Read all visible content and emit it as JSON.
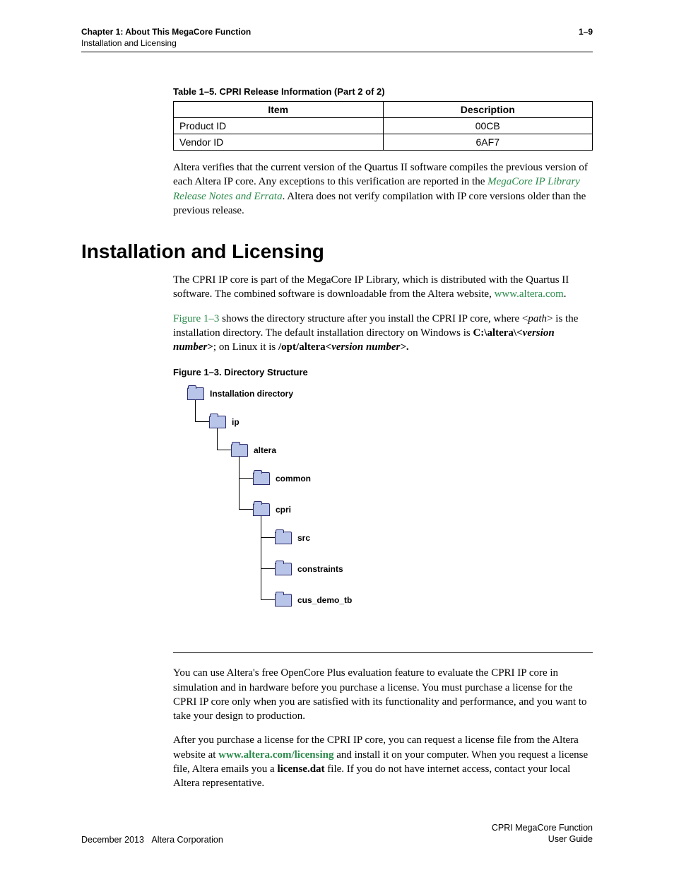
{
  "header": {
    "chapter": "Chapter 1: About This MegaCore Function",
    "section": "Installation and Licensing",
    "pagenum": "1–9"
  },
  "table": {
    "caption": "Table 1–5. CPRI Release Information  (Part 2 of 2)",
    "head_item": "Item",
    "head_desc": "Description",
    "rows": [
      {
        "item": "Product ID",
        "desc": "00CB"
      },
      {
        "item": "Vendor ID",
        "desc": "6AF7"
      }
    ]
  },
  "para1_a": "Altera verifies that the current version of the Quartus II software compiles the previous version of each Altera IP core. Any exceptions to this verification are reported in the ",
  "para1_link": "MegaCore IP Library Release Notes and Errata",
  "para1_b": ". Altera does not verify compilation with IP core versions older than the previous release.",
  "h1": "Installation and Licensing",
  "para2_a": "The CPRI IP core is part of the MegaCore IP Library, which is distributed with the Quartus II software. The combined software is downloadable from the Altera website, ",
  "para2_link": "www.altera.com",
  "para2_b": ".",
  "para3_ref": "Figure 1–3",
  "para3_a": " shows the directory structure after you install the CPRI IP core, where ",
  "para3_path_pre": "<",
  "para3_path": "path",
  "para3_path_post": ">",
  "para3_b": " is the installation directory. The default installation directory on Windows is ",
  "para3_win_a": "C:\\altera\\<",
  "para3_win_i": "version number",
  "para3_win_b": ">",
  "para3_c": "; on Linux it is ",
  "para3_lin_a": "/opt/altera",
  "para3_lin_i": "<version number>",
  "para3_lin_b": ".",
  "figure_caption": "Figure 1–3. Directory Structure",
  "tree": {
    "n0": "Installation directory",
    "n1": "ip",
    "n2": "altera",
    "n3": "common",
    "n4": "cpri",
    "n5": "src",
    "n6": "constraints",
    "n7": "cus_demo_tb"
  },
  "para4": "You can use Altera's free OpenCore Plus evaluation feature to evaluate the CPRI IP core in simulation and in hardware before you purchase a license. You must purchase a license for the CPRI IP core only when you are satisfied with its functionality and performance, and you want to take your design to production.",
  "para5_a": "After you purchase a license for the CPRI IP core, you can request a license file from the Altera website at ",
  "para5_link": "www.altera.com/licensing",
  "para5_b": " and install it on your computer. When you request a license file, Altera emails you a ",
  "para5_file": "license.dat",
  "para5_c": " file. If you do not have internet access, contact your local Altera representative.",
  "footer": {
    "left_date": "December 2013",
    "left_org": "Altera Corporation",
    "right1": "CPRI MegaCore Function",
    "right2": "User Guide"
  }
}
